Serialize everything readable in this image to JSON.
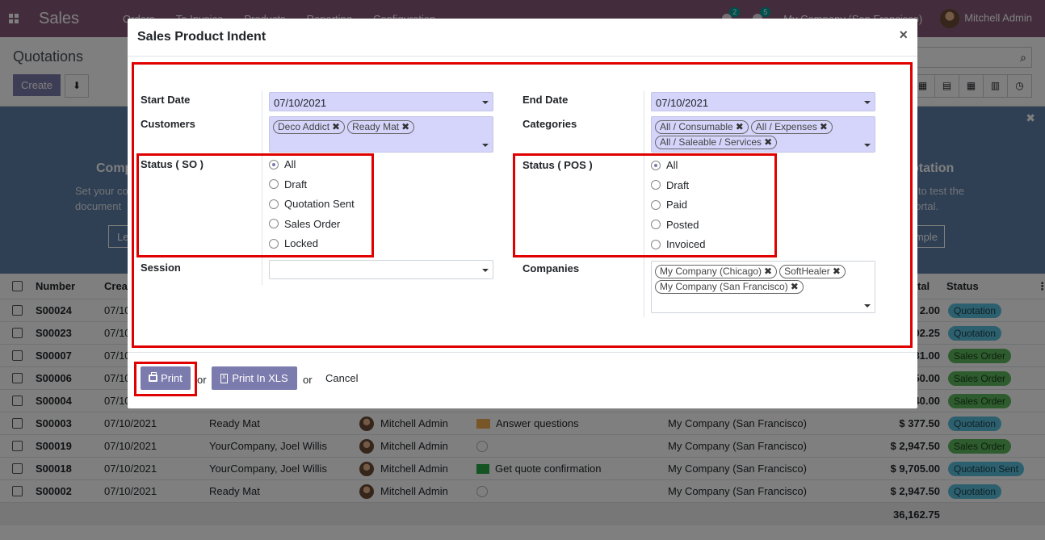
{
  "app": {
    "brand": "Sales",
    "menu": [
      "Orders",
      "To Invoice",
      "Products",
      "Reporting",
      "Configuration"
    ],
    "activity_count": "2",
    "message_count": "5",
    "company": "My Company (San Francisco)",
    "user": "Mitchell Admin"
  },
  "control_panel": {
    "title": "Quotations",
    "create_label": "Create",
    "download_icon": "download-icon",
    "search_icon": "search-icon"
  },
  "banner": {
    "left_heading": "Comp",
    "left_text_1": "Set your co",
    "left_text_2": "document",
    "left_btn": "Le",
    "right_heading": "otation",
    "right_text_1": "n to test the",
    "right_text_2": "portal.",
    "right_btn": "mple"
  },
  "list": {
    "headers": {
      "number": "Number",
      "created": "Crea",
      "total": "tal",
      "status": "Status"
    },
    "rows": [
      {
        "number": "S00024",
        "date": "07/10",
        "customer": "",
        "salesperson": "",
        "activity": "",
        "company": "",
        "total": "2.00",
        "status": "Quotation"
      },
      {
        "number": "S00023",
        "date": "07/10",
        "customer": "",
        "salesperson": "",
        "activity": "",
        "company": "",
        "total": "92.25",
        "status": "Quotation"
      },
      {
        "number": "S00007",
        "date": "07/10",
        "customer": "",
        "salesperson": "",
        "activity": "",
        "company": "",
        "total": "81.00",
        "status": "Sales Order"
      },
      {
        "number": "S00006",
        "date": "07/10",
        "customer": "",
        "salesperson": "",
        "activity": "",
        "company": "",
        "total": "50.00",
        "status": "Sales Order"
      },
      {
        "number": "S00004",
        "date": "07/10",
        "customer": "",
        "salesperson": "",
        "activity": "",
        "company": "",
        "total": "40.00",
        "status": "Sales Order"
      },
      {
        "number": "S00003",
        "date": "07/10/2021",
        "customer": "Ready Mat",
        "salesperson": "Mitchell Admin",
        "activity": "Answer questions",
        "company": "My Company (San Francisco)",
        "total": "$ 377.50",
        "status": "Quotation"
      },
      {
        "number": "S00019",
        "date": "07/10/2021",
        "customer": "YourCompany, Joel Willis",
        "salesperson": "Mitchell Admin",
        "activity": "",
        "company": "My Company (San Francisco)",
        "total": "$ 2,947.50",
        "status": "Sales Order"
      },
      {
        "number": "S00018",
        "date": "07/10/2021",
        "customer": "YourCompany, Joel Willis",
        "salesperson": "Mitchell Admin",
        "activity": "Get quote confirmation",
        "company": "My Company (San Francisco)",
        "total": "$ 9,705.00",
        "status": "Quotation Sent"
      },
      {
        "number": "S00002",
        "date": "07/10/2021",
        "customer": "Ready Mat",
        "salesperson": "Mitchell Admin",
        "activity": "",
        "company": "My Company (San Francisco)",
        "total": "$ 2,947.50",
        "status": "Quotation"
      }
    ],
    "grand_total": "36,162.75"
  },
  "dialog": {
    "title": "Sales Product Indent",
    "close": "×",
    "start_date_label": "Start Date",
    "start_date_value": "07/10/2021",
    "end_date_label": "End Date",
    "end_date_value": "07/10/2021",
    "customers_label": "Customers",
    "customers": [
      "Deco Addict",
      "Ready Mat"
    ],
    "categories_label": "Categories",
    "categories": [
      "All / Consumable",
      "All / Expenses",
      "All / Saleable / Services"
    ],
    "status_so_label": "Status ( SO )",
    "status_so_options": [
      "All",
      "Draft",
      "Quotation Sent",
      "Sales Order",
      "Locked"
    ],
    "status_so_selected": "All",
    "status_pos_label": "Status ( POS )",
    "status_pos_options": [
      "All",
      "Draft",
      "Paid",
      "Posted",
      "Invoiced"
    ],
    "status_pos_selected": "All",
    "session_label": "Session",
    "session_value": "",
    "companies_label": "Companies",
    "companies": [
      "My Company (Chicago)",
      "SoftHealer",
      "My Company (San Francisco)"
    ],
    "print_label": "Print",
    "print_xls_label": "Print In XLS",
    "or_1": "or",
    "or_2": "or",
    "cancel_label": "Cancel"
  },
  "colors": {
    "brand": "#875A7B",
    "button": "#7C7BAD",
    "highlight": "#e00000",
    "required_field": "#d5d5fb"
  }
}
